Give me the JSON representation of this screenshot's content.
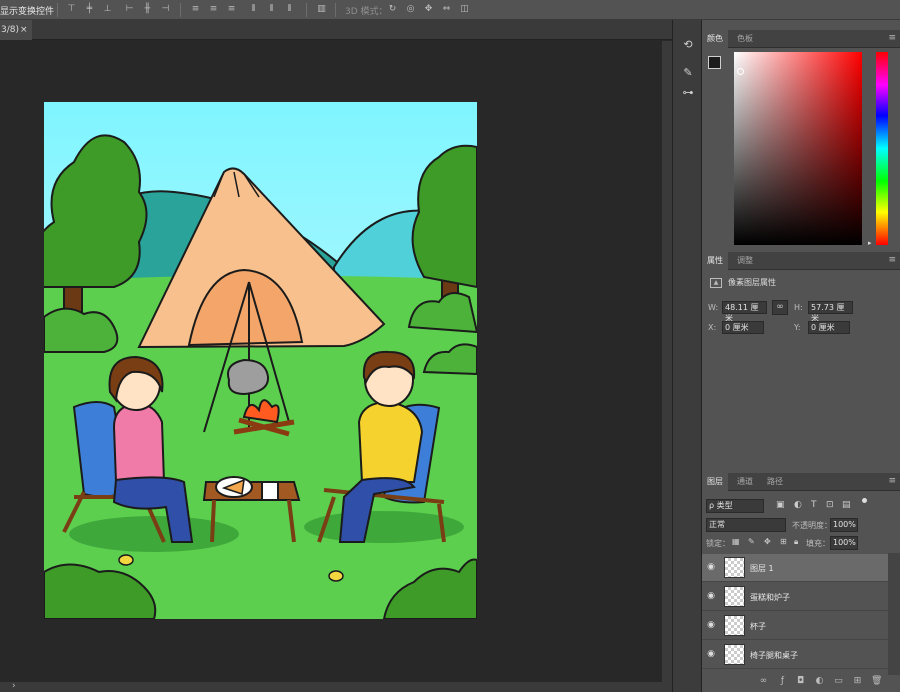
{
  "options_bar": {
    "show_transform_label": "显示变换控件",
    "mode_label": "3D 模式："
  },
  "document": {
    "tab_label": "3/8)",
    "close_glyph": "×"
  },
  "hscroll": {
    "left_arrow": "›"
  },
  "color_panel": {
    "tabs": [
      "颜色",
      "色板"
    ],
    "foreground_color": "#1c1c1c",
    "background_color": "#f0f0f0",
    "field_hue": "#ff0000"
  },
  "properties_panel": {
    "tabs": [
      "属性",
      "调整"
    ],
    "title": "像素图层属性",
    "w_label": "W:",
    "w_value": "48.11 厘米",
    "h_label": "H:",
    "h_value": "57.73 厘米",
    "x_label": "X:",
    "x_value": "0 厘米",
    "y_label": "Y:",
    "y_value": "0 厘米",
    "link_glyph": "∞"
  },
  "layers_panel": {
    "tabs": [
      "图层",
      "通道",
      "路径"
    ],
    "filter_label": "ρ 类型",
    "blend_mode": "正常",
    "opacity_label": "不透明度：",
    "opacity_value": "100%",
    "lock_label": "锁定：",
    "fill_label": "填充：",
    "fill_value": "100%",
    "layers": [
      {
        "name": "图层 1",
        "selected": true
      },
      {
        "name": "蛋糕和炉子",
        "selected": false
      },
      {
        "name": "杯子",
        "selected": false
      },
      {
        "name": "椅子腿和桌子",
        "selected": false
      }
    ]
  },
  "colors": {
    "sky_top": "#7ff5ff",
    "grass": "#5ccf4f",
    "tent": "#f7c08d",
    "hill": "#2aa39a",
    "tree": "#3e9b27"
  }
}
